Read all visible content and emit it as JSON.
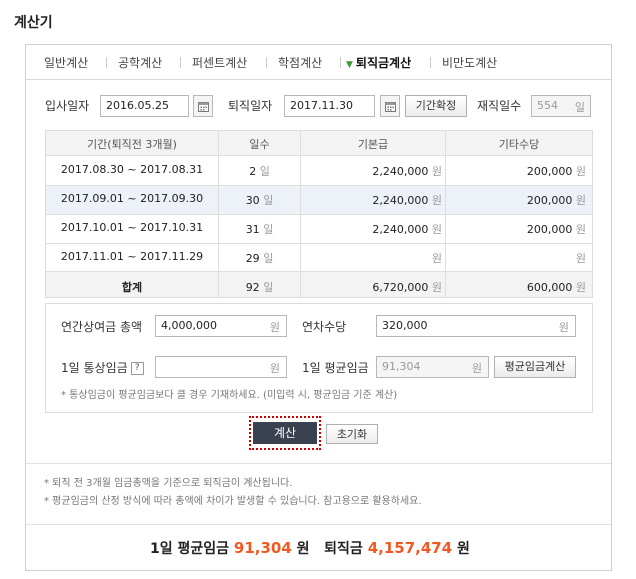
{
  "app": {
    "title": "계산기"
  },
  "tabs": [
    {
      "label": "일반계산"
    },
    {
      "label": "공학계산"
    },
    {
      "label": "퍼센트계산"
    },
    {
      "label": "학점계산"
    },
    {
      "label": "퇴직금계산"
    },
    {
      "label": "비만도계산"
    }
  ],
  "inputs": {
    "start_label": "입사일자",
    "start_value": "2016.05.25",
    "end_label": "퇴직일자",
    "end_value": "2017.11.30",
    "confirm_button": "기간확정",
    "days_label": "재직일수",
    "days_value": "554",
    "days_unit": "일"
  },
  "table": {
    "headers": [
      "기간(퇴직전 3개월)",
      "일수",
      "기본급",
      "기타수당"
    ],
    "rows": [
      {
        "period": "2017.08.30 ~ 2017.08.31",
        "days": "2",
        "days_unit": "일",
        "base": "2,240,000",
        "base_unit": "원",
        "extra": "200,000",
        "extra_unit": "원"
      },
      {
        "period": "2017.09.01 ~ 2017.09.30",
        "days": "30",
        "days_unit": "일",
        "base": "2,240,000",
        "base_unit": "원",
        "extra": "200,000",
        "extra_unit": "원"
      },
      {
        "period": "2017.10.01 ~ 2017.10.31",
        "days": "31",
        "days_unit": "일",
        "base": "2,240,000",
        "base_unit": "원",
        "extra": "200,000",
        "extra_unit": "원"
      },
      {
        "period": "2017.11.01 ~ 2017.11.29",
        "days": "29",
        "days_unit": "일",
        "base": "",
        "base_unit": "원",
        "extra": "",
        "extra_unit": "원"
      }
    ],
    "total": {
      "label": "합계",
      "days": "92",
      "days_unit": "일",
      "base": "6,720,000",
      "base_unit": "원",
      "extra": "600,000",
      "extra_unit": "원"
    }
  },
  "extra_fields": {
    "bonus_label": "연간상여금 총액",
    "bonus_value": "4,000,000",
    "bonus_unit": "원",
    "annual_leave_label": "연차수당",
    "annual_leave_value": "320,000",
    "annual_leave_unit": "원",
    "ordinary_wage_label": "1일 통상임금",
    "ordinary_wage_help": "?",
    "ordinary_wage_value": "",
    "ordinary_wage_unit": "원",
    "avg_wage_label": "1일 평균임금",
    "avg_wage_value": "91,304",
    "avg_wage_unit": "원",
    "avg_wage_button": "평균임금계산",
    "note": "* 통상임금이 평균임금보다 클 경우 기재하세요. (미입력 시, 평균임금 기준 계산)"
  },
  "actions": {
    "calculate": "계산",
    "reset": "초기화"
  },
  "notes": [
    "* 퇴직 전 3개월 임금총액을 기준으로 퇴직금이 계산됩니다.",
    "* 평균임금의 산정 방식에 따라 총액에 차이가 발생할 수 있습니다. 참고용으로 활용하세요."
  ],
  "result": {
    "avg_label": "1일 평균임금",
    "avg_value": "91,304",
    "avg_unit": "원",
    "severance_label": "퇴직금",
    "severance_value": "4,157,474",
    "severance_unit": "원"
  }
}
